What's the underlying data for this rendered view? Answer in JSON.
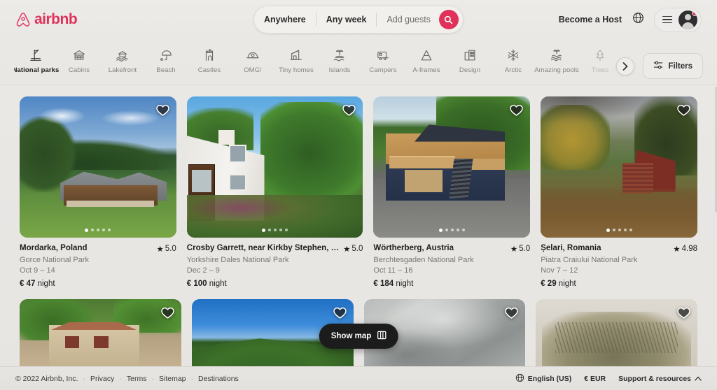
{
  "brand": {
    "name": "airbnb",
    "color": "#e0315b"
  },
  "search": {
    "where": "Anywhere",
    "when": "Any week",
    "guests": "Add guests",
    "search_icon": "search-icon"
  },
  "header": {
    "become_host": "Become a Host",
    "globe_icon": "globe-icon",
    "menu_icon": "hamburger-icon",
    "avatar_icon": "user-avatar-icon"
  },
  "categories": [
    {
      "label": "National parks",
      "icon": "national-parks-icon",
      "active": true
    },
    {
      "label": "Cabins",
      "icon": "cabin-icon",
      "active": false
    },
    {
      "label": "Lakefront",
      "icon": "lakefront-icon",
      "active": false
    },
    {
      "label": "Beach",
      "icon": "beach-umbrella-icon",
      "active": false
    },
    {
      "label": "Castles",
      "icon": "castle-icon",
      "active": false
    },
    {
      "label": "OMG!",
      "icon": "omg-icon",
      "active": false
    },
    {
      "label": "Tiny homes",
      "icon": "tiny-home-icon",
      "active": false
    },
    {
      "label": "Islands",
      "icon": "island-icon",
      "active": false
    },
    {
      "label": "Campers",
      "icon": "camper-icon",
      "active": false
    },
    {
      "label": "A-frames",
      "icon": "a-frame-icon",
      "active": false
    },
    {
      "label": "Design",
      "icon": "design-icon",
      "active": false
    },
    {
      "label": "Arctic",
      "icon": "snowflake-icon",
      "active": false
    },
    {
      "label": "Amazing pools",
      "icon": "pool-icon",
      "active": false
    },
    {
      "label": "Trees",
      "icon": "tree-icon",
      "active": false
    }
  ],
  "controls": {
    "next_label": "›",
    "filters_label": "Filters",
    "filters_icon": "filters-icon",
    "show_map_label": "Show map",
    "show_map_icon": "map-icon"
  },
  "listings": [
    {
      "title": "Mordarka, Poland",
      "subtitle": "Gorce National Park",
      "dates": "Oct 9 – 14",
      "price_amount": "€ 47",
      "price_unit": "night",
      "rating": "5.0",
      "photo": "wooden-lodge-green-hills",
      "dots": 5,
      "active_dot": 0
    },
    {
      "title": "Crosby Garrett, near Kirkby Stephen, …",
      "subtitle": "Yorkshire Dales National Park",
      "dates": "Dec 2 – 9",
      "price_amount": "€ 100",
      "price_unit": "night",
      "rating": "5.0",
      "photo": "white-cottage-garden",
      "dots": 5,
      "active_dot": 0
    },
    {
      "title": "Wörtherberg, Austria",
      "subtitle": "Berchtesgaden National Park",
      "dates": "Oct 11 – 16",
      "price_amount": "€ 184",
      "price_unit": "night",
      "rating": "5.0",
      "photo": "modern-wood-chalet",
      "dots": 5,
      "active_dot": 0
    },
    {
      "title": "Șelari, Romania",
      "subtitle": "Piatra Craiului National Park",
      "dates": "Nov 7 – 12",
      "price_amount": "€ 29",
      "price_unit": "night",
      "rating": "4.98",
      "photo": "red-cabin-autumn",
      "dots": 5,
      "active_dot": 0
    }
  ],
  "listings_row2": [
    {
      "photo": "stone-villa-trees"
    },
    {
      "photo": "forested-hill-blue-sky"
    },
    {
      "photo": "misty-grey-clouds"
    },
    {
      "photo": "windswept-trees"
    }
  ],
  "footer": {
    "copyright": "© 2022 Airbnb, Inc.",
    "links": [
      "Privacy",
      "Terms",
      "Sitemap",
      "Destinations"
    ],
    "language": "English (US)",
    "currency": "€ EUR",
    "support": "Support & resources",
    "support_chevron": "chevron-up-icon",
    "globe_icon": "globe-icon"
  }
}
